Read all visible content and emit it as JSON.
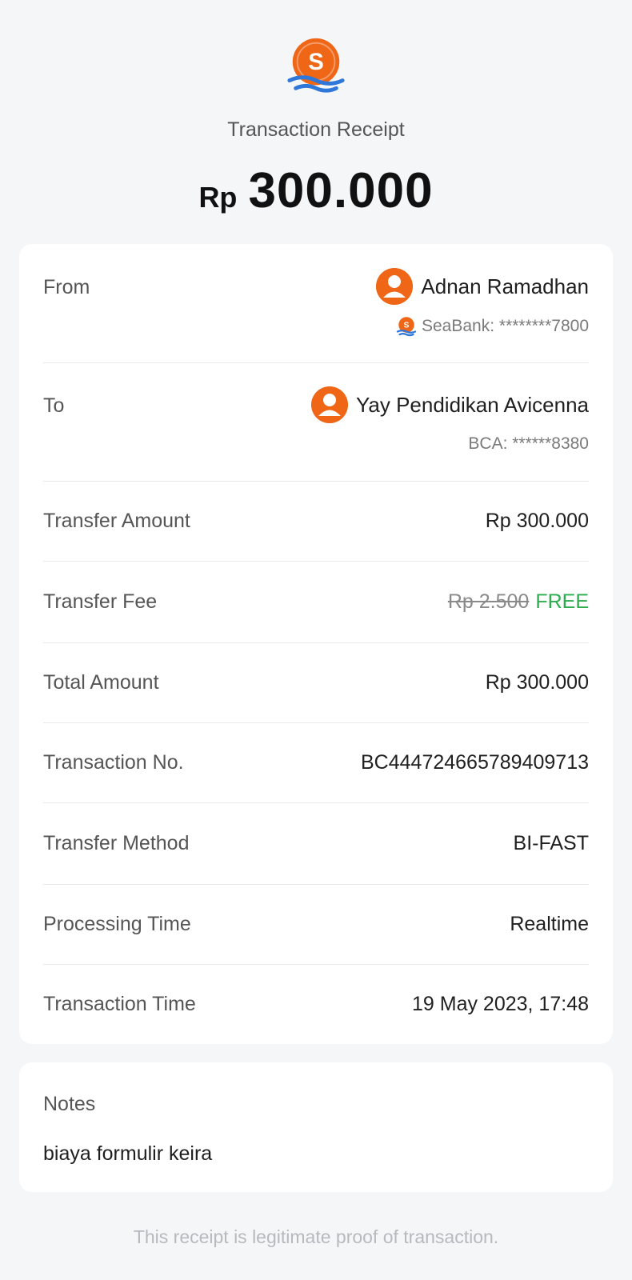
{
  "header": {
    "logo_icon": "seabank-logo-icon",
    "title": "Transaction Receipt",
    "currency": "Rp",
    "amount": "300.000"
  },
  "from": {
    "label": "From",
    "name": "Adnan Ramadhan",
    "account": "SeaBank: ********7800",
    "avatar_icon": "user-avatar-icon",
    "bank_icon": "seabank-logo-icon"
  },
  "to": {
    "label": "To",
    "name": "Yay Pendidikan Avicenna",
    "account": "BCA: ******8380",
    "avatar_icon": "user-avatar-icon"
  },
  "rows": {
    "transfer_amount": {
      "label": "Transfer Amount",
      "value": "Rp 300.000"
    },
    "transfer_fee": {
      "label": "Transfer Fee",
      "old_value": "Rp 2.500",
      "value": "FREE"
    },
    "total_amount": {
      "label": "Total Amount",
      "value": "Rp 300.000"
    },
    "transaction_no": {
      "label": "Transaction No.",
      "value": "BC444724665789409713"
    },
    "transfer_method": {
      "label": "Transfer Method",
      "value": "BI-FAST"
    },
    "processing_time": {
      "label": "Processing Time",
      "value": "Realtime"
    },
    "transaction_time": {
      "label": "Transaction Time",
      "value": "19 May 2023, 17:48"
    }
  },
  "notes": {
    "label": "Notes",
    "text": "biaya formulir keira"
  },
  "footer": {
    "text": "This receipt is legitimate proof of transaction."
  },
  "colors": {
    "accent_orange": "#ee6616",
    "wave_blue": "#2f77d8",
    "free_green": "#2cad4e",
    "background": "#f5f6f8"
  }
}
